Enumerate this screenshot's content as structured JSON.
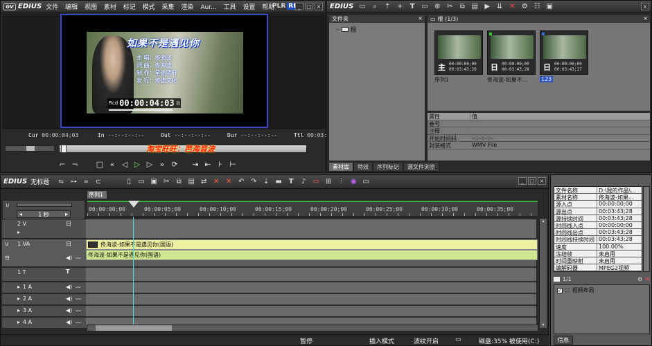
{
  "app": {
    "logo": "EDIUS",
    "logo_mark": "GV"
  },
  "menu": [
    "文件",
    "编辑",
    "视图",
    "素材",
    "标记",
    "模式",
    "采集",
    "渲染",
    "Aur...",
    "工具",
    "设置",
    "帮助"
  ],
  "player": {
    "plr": "PLR",
    "rec": "REC",
    "video_title": "如果不是遇见你",
    "credits": [
      {
        "k": "主  唱",
        "v": "佟海波"
      },
      {
        "k": "词  曲",
        "v": "佟海波"
      },
      {
        "k": "制  作",
        "v": "星途蓝轩"
      },
      {
        "k": "发  行",
        "v": "佟途文化"
      }
    ],
    "rec_label": "Rcd",
    "rec_timecode": "00:00:04:03",
    "cur_label": "Cur",
    "cur": "00:00:04;03",
    "in_label": "In",
    "in": "--:--:--:--",
    "out_label": "Out",
    "out": "--:--:--:--",
    "dur_label": "Dur",
    "dur": "--:--:--:--",
    "ttl_label": "Ttl",
    "ttl": "00:03:43;28",
    "watermark": "淘宝旺旺：芭海音波"
  },
  "bin": {
    "logo": "EDIUS",
    "folder_header": "文件夹",
    "root": "根",
    "path": "根 (1/3)",
    "clips": [
      {
        "type": "主",
        "tc1": "00:00:00;00",
        "tc2": "00:03:43;28",
        "name": "序列1"
      },
      {
        "type": "日",
        "tc1": "00:00:00;00",
        "tc2": "00:03:43;28",
        "name": "佟海波-如果不..."
      },
      {
        "type": "日",
        "tc1": "00:00:00;00",
        "tc2": "00:03:43;27",
        "name": "123"
      }
    ],
    "props_header": [
      "属性",
      "值"
    ],
    "props": [
      {
        "k": "卷号",
        "v": ""
      },
      {
        "k": "注释",
        "v": ""
      },
      {
        "k": "开始时间码",
        "v": "--:--:--:--"
      },
      {
        "k": "封装格式",
        "v": "WMV File"
      }
    ],
    "tabs": [
      "素材库",
      "特效",
      "序列标记",
      "源文件浏览"
    ]
  },
  "timeline": {
    "logo": "EDIUS",
    "project": "无标题",
    "seq_tab": "序列1",
    "zoom": "1 秒",
    "ruler": [
      "00:00:00;00",
      "00:00:05;00",
      "00:00:10;00",
      "00:00:15;00",
      "00:00:20;00",
      "00:00:25;00",
      "00:00:30;00",
      "00:00:35;00"
    ],
    "tracks": {
      "v2": "2 V",
      "va1": "1 VA",
      "t1": "1 T",
      "a1": "1 A",
      "a2": "2 A",
      "a3": "3 A",
      "a4": "4 A"
    },
    "clip_video": "佟海波-如果不是遇见你(国语)",
    "clip_audio": "佟海波-如果不是遇见你(国语)"
  },
  "info_panel": {
    "rows": [
      {
        "k": "文件名称",
        "v": "D:\\我的作品\\..."
      },
      {
        "k": "素材名称",
        "v": "佟海波-如果..."
      },
      {
        "k": "源入点",
        "v": "00:00:00;00"
      },
      {
        "k": "源出点",
        "v": "00:03:43;28"
      },
      {
        "k": "源持续时间",
        "v": "00:03:43;28"
      },
      {
        "k": "时间线入点",
        "v": "00:00:00;00"
      },
      {
        "k": "时间线出点",
        "v": "00:03:43;28"
      },
      {
        "k": "时间线持续时间",
        "v": "00:03:43;28"
      },
      {
        "k": "速度",
        "v": "100.00%"
      },
      {
        "k": "冻结帧",
        "v": "未启用"
      },
      {
        "k": "时间重映射",
        "v": "未启用"
      },
      {
        "k": "编解码器",
        "v": "MPEG2视频"
      }
    ],
    "page": "1/1",
    "effect": "视频布局",
    "tab": "信息"
  },
  "status": {
    "pause": "暂停",
    "insert": "插入模式",
    "ripple": "波纹开启",
    "disk": "磁盘:35% 被使用(C:)"
  },
  "colors": {
    "accent_green": "#cfe88f",
    "clip_yellow": "#eef0a0",
    "blue_border": "#3a47c8"
  }
}
